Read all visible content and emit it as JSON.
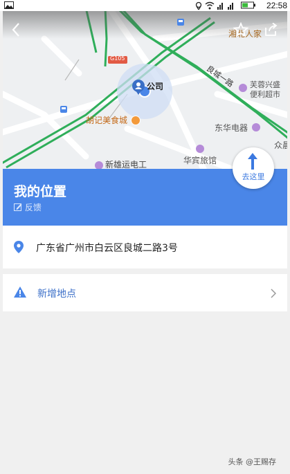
{
  "status_bar": {
    "time": "22:58"
  },
  "map": {
    "road_g105": "G105",
    "road_liangcheng": "良城一路",
    "poi_company": "公司",
    "poi_huji": "胡记美食城",
    "poi_dongfang": "东华电器",
    "poi_xinxiong": "新雄运电工",
    "poi_huabin": "华宾旅馆",
    "poi_furong_1": "芙蓉兴盛",
    "poi_furong_2": "便利超市",
    "poi_hunan": "湘北人家",
    "poi_edge": "众晨"
  },
  "goto_button": {
    "label": "去这里"
  },
  "location": {
    "title": "我的位置",
    "feedback": "反馈",
    "address": "广东省广州市白云区良城二路3号"
  },
  "add_place": {
    "label": "新增地点"
  },
  "watermark": "头条 @王赐存",
  "colors": {
    "accent": "#4a86e8",
    "road_green": "#2fae5a"
  }
}
